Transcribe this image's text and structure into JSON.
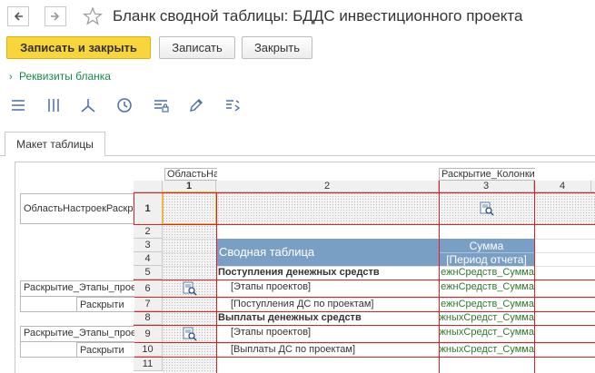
{
  "title": "Бланк сводной таблицы: БДДС инвестиционного проекта",
  "buttons": {
    "save_close": "Записать и закрыть",
    "save": "Записать",
    "close": "Закрыть"
  },
  "link": "Реквизиты бланка",
  "tab": "Макет таблицы",
  "areas": {
    "col_area": "ОбластьНа",
    "col_area2": "Раскрытие_Колонки",
    "row_area": "ОбластьНастроекРаскр"
  },
  "col_headers": [
    "1",
    "2",
    "3",
    "4"
  ],
  "row_headers": [
    "1",
    "2",
    "3",
    "4",
    "5",
    "6",
    "7",
    "8",
    "9",
    "10",
    "11"
  ],
  "groups": {
    "g1_outer": "Раскрытие_Этапы_прое",
    "g1_inner": "Раскрыти",
    "g2_outer": "Раскрытие_Этапы_прое",
    "g2_inner": "Раскрыти"
  },
  "table": {
    "header_title": "Сводная таблица",
    "sum": "Сумма",
    "period": "[Период отчета]",
    "r5": "Поступления денежных средств",
    "r6": "[Этапы проектов]",
    "r7": "[Поступления ДС по проектам]",
    "r8": "Выплаты денежных средств",
    "r9": "[Этапы проектов]",
    "r10": "[Выплаты ДС по проектам]",
    "r5_val": "ежнСредств_Сумма",
    "r6_val": "ежнСредств_Сумма",
    "r7_val": "ежнСредств_Сумма",
    "r8_val": "жныхСредст_Сумма",
    "r9_val": "жныхСредст_Сумма",
    "r10_val": "жныхСредст_Сумма"
  },
  "colors": {
    "accent": "#f8d53a",
    "link": "#1a8a4a",
    "header_blue": "#7a9fc4",
    "red": "#e02020"
  }
}
